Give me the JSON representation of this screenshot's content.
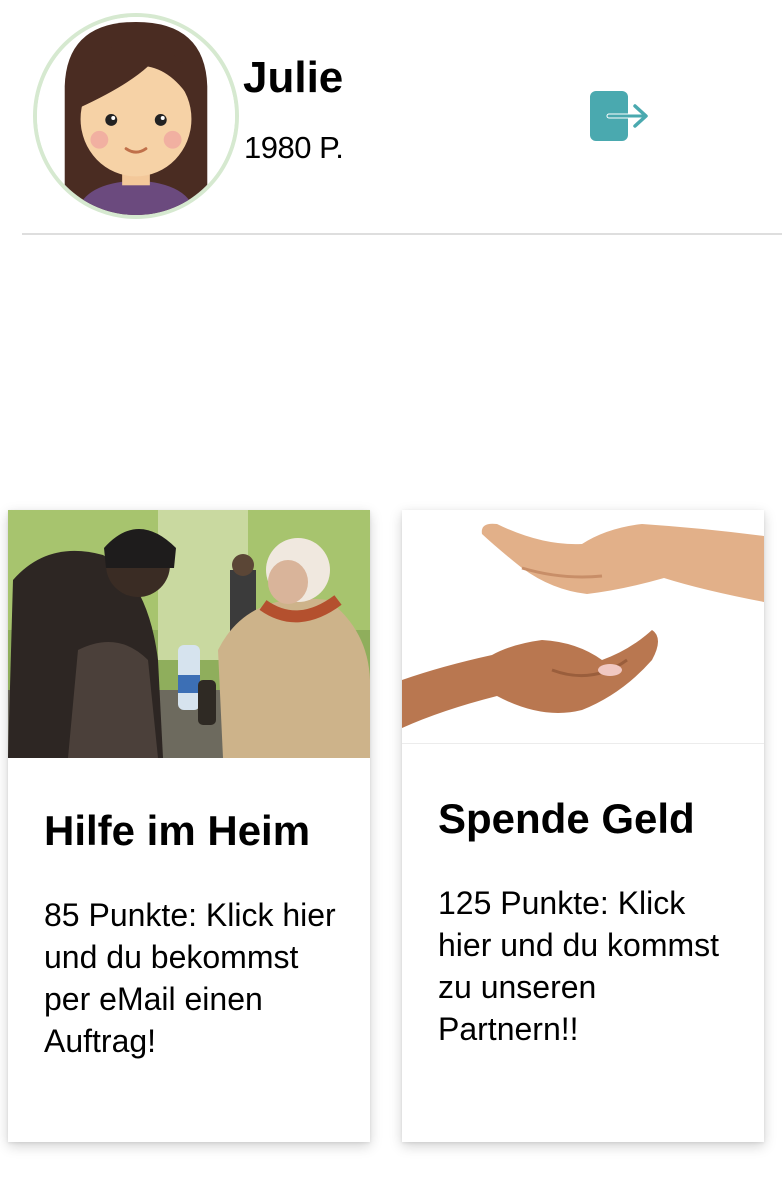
{
  "profile": {
    "name": "Julie",
    "points": "1980 P.",
    "avatar_icon": "girl-avatar-icon",
    "logout_icon": "logout-icon",
    "accent_color": "#4aa9af"
  },
  "cards": [
    {
      "title": "Hilfe im Heim",
      "text": "85 Punkte: Klick hier und du bekommst per eMail einen Auftrag!",
      "image": "volunteers-helping-homeless-photo"
    },
    {
      "title": "Spende Geld",
      "text": "125 Punkte: Klick hier und du kommst zu unseren Partnern!!",
      "image": "giving-hands-photo"
    }
  ]
}
